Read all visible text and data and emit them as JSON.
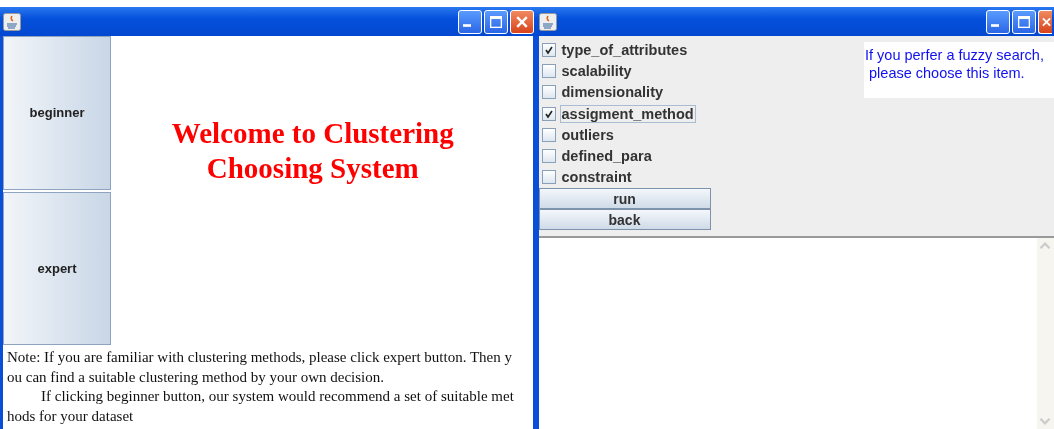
{
  "left_window": {
    "mode_buttons": [
      "beginner",
      "expert"
    ],
    "welcome": [
      "Welcome to Clustering",
      "Choosing System"
    ],
    "note_lines": [
      "Note: If you are familiar with clustering methods, please click expert button. Then y",
      "ou can find a suitable clustering method by your own decision.",
      "If clicking beginner button, our system would recommend a set of suitable met",
      "hods for your dataset"
    ]
  },
  "right_window": {
    "options": [
      {
        "label": "type_of_attributes",
        "checked": true,
        "focused": false
      },
      {
        "label": "scalability",
        "checked": false,
        "focused": false
      },
      {
        "label": "dimensionality",
        "checked": false,
        "focused": false
      },
      {
        "label": "assigment_method",
        "checked": true,
        "focused": true
      },
      {
        "label": "outliers",
        "checked": false,
        "focused": false
      },
      {
        "label": "defined_para",
        "checked": false,
        "focused": false
      },
      {
        "label": "constraint",
        "checked": false,
        "focused": false
      }
    ],
    "hint_lines": [
      "If you perfer a fuzzy search,",
      " please choose this item."
    ],
    "buttons": [
      "run",
      "back"
    ]
  }
}
